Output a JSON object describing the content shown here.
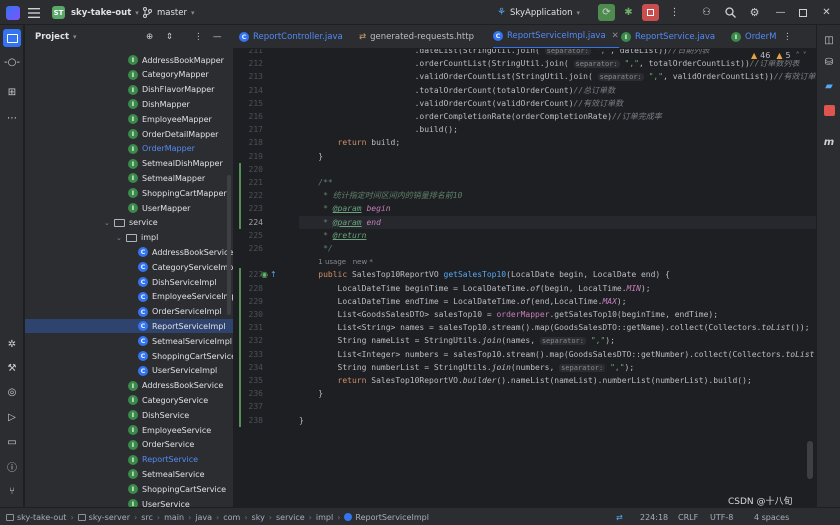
{
  "titlebar": {
    "project_badge": "ST",
    "project_name": "sky-take-out",
    "branch": "master",
    "run_config": "SkyApplication"
  },
  "project_panel": {
    "title": "Project",
    "rows": [
      {
        "label": "AddressBookMapper",
        "kind": "i"
      },
      {
        "label": "CategoryMapper",
        "kind": "i"
      },
      {
        "label": "DishFlavorMapper",
        "kind": "i"
      },
      {
        "label": "DishMapper",
        "kind": "i"
      },
      {
        "label": "EmployeeMapper",
        "kind": "i"
      },
      {
        "label": "OrderDetailMapper",
        "kind": "i"
      },
      {
        "label": "OrderMapper",
        "kind": "i"
      },
      {
        "label": "SetmealDishMapper",
        "kind": "i"
      },
      {
        "label": "SetmealMapper",
        "kind": "i"
      },
      {
        "label": "ShoppingCartMapper",
        "kind": "i"
      },
      {
        "label": "UserMapper",
        "kind": "i"
      },
      {
        "label": "service",
        "kind": "folder"
      },
      {
        "label": "impl",
        "kind": "folder"
      },
      {
        "label": "AddressBookServiceI",
        "kind": "c"
      },
      {
        "label": "CategoryServiceImpl",
        "kind": "c"
      },
      {
        "label": "DishServiceImpl",
        "kind": "c"
      },
      {
        "label": "EmployeeServiceImpl",
        "kind": "c"
      },
      {
        "label": "OrderServiceImpl",
        "kind": "c"
      },
      {
        "label": "ReportServiceImpl",
        "kind": "c"
      },
      {
        "label": "SetmealServiceImpl",
        "kind": "c"
      },
      {
        "label": "ShoppingCartServicel",
        "kind": "c"
      },
      {
        "label": "UserServiceImpl",
        "kind": "c"
      },
      {
        "label": "AddressBookService",
        "kind": "i"
      },
      {
        "label": "CategoryService",
        "kind": "i"
      },
      {
        "label": "DishService",
        "kind": "i"
      },
      {
        "label": "EmployeeService",
        "kind": "i"
      },
      {
        "label": "OrderService",
        "kind": "i"
      },
      {
        "label": "ReportService",
        "kind": "i"
      },
      {
        "label": "SetmealService",
        "kind": "i"
      },
      {
        "label": "ShoppingCartService",
        "kind": "i"
      },
      {
        "label": "UserService",
        "kind": "i"
      }
    ]
  },
  "tabs": [
    {
      "label": "ReportController.java"
    },
    {
      "label": "generated-requests.http"
    },
    {
      "label": "ReportServiceImpl.java"
    },
    {
      "label": "ReportService.java"
    },
    {
      "label": "OrderM"
    }
  ],
  "editor": {
    "inspection_warnings": "46",
    "inspection_weak": "5",
    "line_numbers": [
      "211",
      "212",
      "213",
      "214",
      "215",
      "216",
      "217",
      "218",
      "219",
      "220",
      "221",
      "222",
      "223",
      "224",
      "225",
      "226",
      "",
      "227",
      "228",
      "229",
      "230",
      "231",
      "232",
      "233",
      "234",
      "235",
      "236",
      "237",
      "238"
    ],
    "usages": "1 usage",
    "new_marker": "new *"
  },
  "statusbar": {
    "breadcrumb": [
      "sky-take-out",
      "sky-server",
      "src",
      "main",
      "java",
      "com",
      "sky",
      "service",
      "impl",
      "ReportServiceImpl"
    ],
    "position": "224:18",
    "line_sep": "CRLF",
    "encoding": "UTF-8",
    "indent": "4 spaces",
    "watermark": "CSDN @十八旬"
  }
}
